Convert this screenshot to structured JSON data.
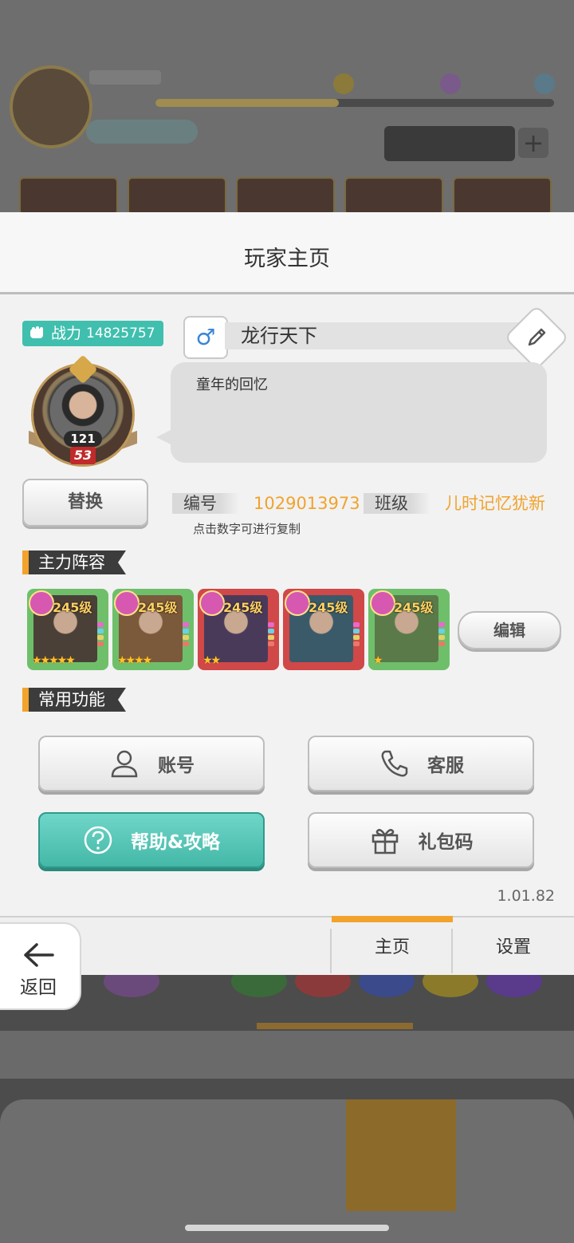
{
  "dialog": {
    "title": "玩家主页",
    "power": {
      "label": "战力",
      "value": "14825757"
    },
    "avatar": {
      "level_small": "121",
      "level_big": "53"
    },
    "replace_label": "替换",
    "gender_symbol": "♂",
    "player_name": "龙行天下",
    "signature": "童年的回忆",
    "id_label": "编号",
    "id_value": "1029013973",
    "class_label": "班级",
    "class_value": "儿时记忆犹新",
    "copy_hint": "点击数字可进行复制",
    "lineup_title": "主力阵容",
    "heroes": [
      {
        "level": "245级",
        "stars": "★★★★★",
        "frame": "#6fbf6a"
      },
      {
        "level": "245级",
        "stars": "★★★★",
        "frame": "#6fbf6a"
      },
      {
        "level": "245级",
        "stars": "★★",
        "frame": "#d04848"
      },
      {
        "level": "245级",
        "stars": "",
        "frame": "#d04848"
      },
      {
        "level": "245级",
        "stars": "★",
        "frame": "#6fbf6a"
      }
    ],
    "edit_lineup_label": "编辑",
    "functions_title": "常用功能",
    "functions": {
      "account": "账号",
      "service": "客服",
      "help": "帮助&攻略",
      "gift_code": "礼包码"
    },
    "version": "1.01.82",
    "tabs": {
      "home": "主页",
      "settings": "设置"
    }
  },
  "back_label": "返回",
  "colors": {
    "accent": "#f1a32c",
    "teal": "#40bfae",
    "gender": "#3a86d6"
  }
}
